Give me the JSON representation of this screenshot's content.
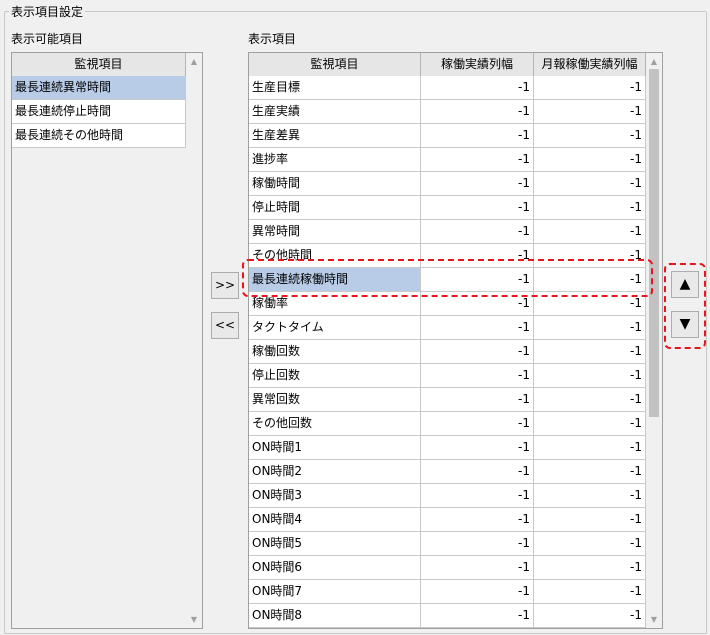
{
  "group_title": "表示項目設定",
  "available": {
    "label": "表示可能項目",
    "header": "監視項目",
    "items": [
      "最長連続異常時間",
      "最長連続停止時間",
      "最長連続その他時間"
    ],
    "selected_index": 0
  },
  "display": {
    "label": "表示項目",
    "headers": [
      "監視項目",
      "稼働実績列幅",
      "月報稼働実績列幅"
    ],
    "rows": [
      [
        "生産目標",
        "-1",
        "-1"
      ],
      [
        "生産実績",
        "-1",
        "-1"
      ],
      [
        "生産差異",
        "-1",
        "-1"
      ],
      [
        "進捗率",
        "-1",
        "-1"
      ],
      [
        "稼働時間",
        "-1",
        "-1"
      ],
      [
        "停止時間",
        "-1",
        "-1"
      ],
      [
        "異常時間",
        "-1",
        "-1"
      ],
      [
        "その他時間",
        "-1",
        "-1"
      ],
      [
        "最長連続稼働時間",
        "-1",
        "-1"
      ],
      [
        "稼働率",
        "-1",
        "-1"
      ],
      [
        "タクトタイム",
        "-1",
        "-1"
      ],
      [
        "稼働回数",
        "-1",
        "-1"
      ],
      [
        "停止回数",
        "-1",
        "-1"
      ],
      [
        "異常回数",
        "-1",
        "-1"
      ],
      [
        "その他回数",
        "-1",
        "-1"
      ],
      [
        "ON時間1",
        "-1",
        "-1"
      ],
      [
        "ON時間2",
        "-1",
        "-1"
      ],
      [
        "ON時間3",
        "-1",
        "-1"
      ],
      [
        "ON時間4",
        "-1",
        "-1"
      ],
      [
        "ON時間5",
        "-1",
        "-1"
      ],
      [
        "ON時間6",
        "-1",
        "-1"
      ],
      [
        "ON時間7",
        "-1",
        "-1"
      ],
      [
        "ON時間8",
        "-1",
        "-1"
      ]
    ],
    "selected_index": 8
  },
  "buttons": {
    "add": ">>",
    "remove": "<<",
    "up": "▲",
    "down": "▼"
  },
  "highlight_color": "#e8141e"
}
